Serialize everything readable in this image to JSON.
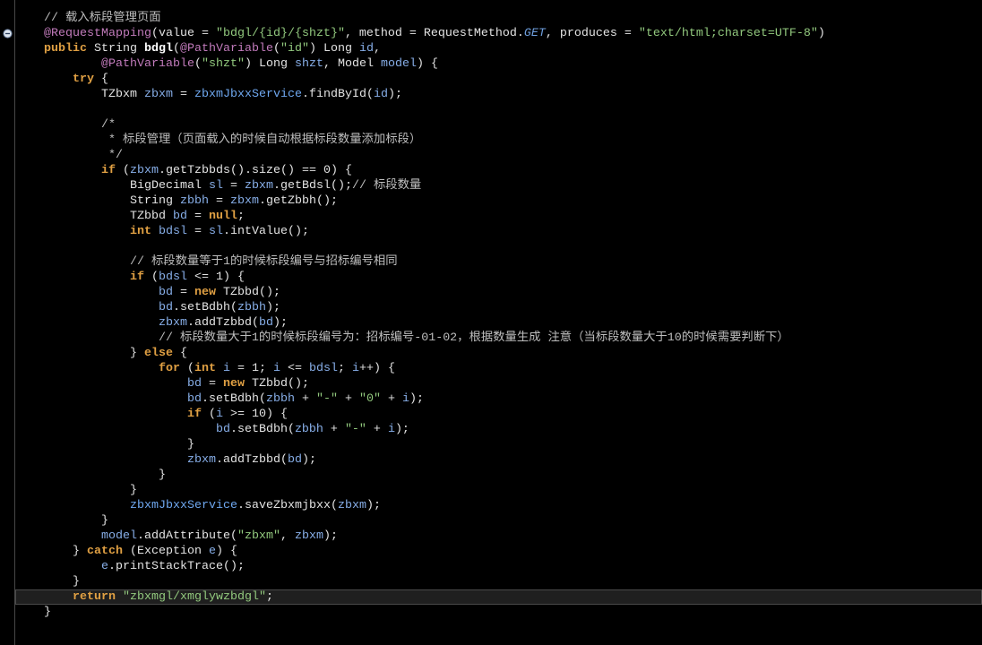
{
  "colors": {
    "background": "#000000",
    "plain": "#e3e3e3",
    "keyword": "#e0a043",
    "annotation": "#c27bbc",
    "string": "#92c97e",
    "comment": "#bdbdbd",
    "variable": "#87aee8",
    "field": "#6fa8f0",
    "static_field": "#6fa0e0",
    "number": "#e3e3e3",
    "method": "#ffffff",
    "current_line": "#1f1f1f",
    "current_line_border": "#4a4a4a",
    "gutter_divider": "#474747"
  },
  "icons": {
    "fold": "fold-collapse-icon"
  },
  "editor": {
    "current_line": 39,
    "fold_markers": [
      2
    ],
    "lines": [
      {
        "tabs": 1,
        "tokens": [
          {
            "comment": "// 载入标段管理页面"
          }
        ]
      },
      {
        "tabs": 1,
        "tokens": [
          {
            "annotation": "@RequestMapping"
          },
          {
            "plain": "(value = "
          },
          {
            "string": "\"bdgl/{id}/{shzt}\""
          },
          {
            "plain": ", method = RequestMethod."
          },
          {
            "static_field": "GET"
          },
          {
            "plain": ", produces = "
          },
          {
            "string": "\"text/html;charset=UTF-8\""
          },
          {
            "plain": ")"
          }
        ]
      },
      {
        "tabs": 1,
        "tokens": [
          {
            "keyword": "public"
          },
          {
            "plain": " String "
          },
          {
            "method": "bdgl"
          },
          {
            "plain": "("
          },
          {
            "annotation": "@PathVariable"
          },
          {
            "plain": "("
          },
          {
            "string": "\"id\""
          },
          {
            "plain": ") Long "
          },
          {
            "variable": "id"
          },
          {
            "plain": ","
          }
        ]
      },
      {
        "tabs": 3,
        "tokens": [
          {
            "annotation": "@PathVariable"
          },
          {
            "plain": "("
          },
          {
            "string": "\"shzt\""
          },
          {
            "plain": ") Long "
          },
          {
            "variable": "shzt"
          },
          {
            "plain": ", Model "
          },
          {
            "variable": "model"
          },
          {
            "plain": ") {"
          }
        ]
      },
      {
        "tabs": 2,
        "tokens": [
          {
            "keyword": "try"
          },
          {
            "plain": " {"
          }
        ]
      },
      {
        "tabs": 3,
        "tokens": [
          {
            "plain": "TZbxm "
          },
          {
            "variable": "zbxm"
          },
          {
            "plain": " = "
          },
          {
            "field": "zbxmJbxxService"
          },
          {
            "plain": ".findById("
          },
          {
            "variable": "id"
          },
          {
            "plain": ");"
          }
        ]
      },
      {
        "tabs": 0,
        "tokens": []
      },
      {
        "tabs": 3,
        "tokens": [
          {
            "comment": "/*"
          }
        ]
      },
      {
        "tabs": 3,
        "tokens": [
          {
            "comment": " * 标段管理（页面载入的时候自动根据标段数量添加标段）"
          }
        ]
      },
      {
        "tabs": 3,
        "tokens": [
          {
            "comment": " */"
          }
        ]
      },
      {
        "tabs": 3,
        "tokens": [
          {
            "keyword": "if"
          },
          {
            "plain": " ("
          },
          {
            "variable": "zbxm"
          },
          {
            "plain": ".getTzbbds().size() == "
          },
          {
            "number": "0"
          },
          {
            "plain": ") {"
          }
        ]
      },
      {
        "tabs": 4,
        "tokens": [
          {
            "plain": "BigDecimal "
          },
          {
            "variable": "sl"
          },
          {
            "plain": " = "
          },
          {
            "variable": "zbxm"
          },
          {
            "plain": ".getBdsl();"
          },
          {
            "comment": "// 标段数量"
          }
        ]
      },
      {
        "tabs": 4,
        "tokens": [
          {
            "plain": "String "
          },
          {
            "variable": "zbbh"
          },
          {
            "plain": " = "
          },
          {
            "variable": "zbxm"
          },
          {
            "plain": ".getZbbh();"
          }
        ]
      },
      {
        "tabs": 4,
        "tokens": [
          {
            "plain": "TZbbd "
          },
          {
            "variable": "bd"
          },
          {
            "plain": " = "
          },
          {
            "keyword": "null"
          },
          {
            "plain": ";"
          }
        ]
      },
      {
        "tabs": 4,
        "tokens": [
          {
            "keyword": "int"
          },
          {
            "plain": " "
          },
          {
            "variable": "bdsl"
          },
          {
            "plain": " = "
          },
          {
            "variable": "sl"
          },
          {
            "plain": ".intValue();"
          }
        ]
      },
      {
        "tabs": 0,
        "tokens": []
      },
      {
        "tabs": 4,
        "tokens": [
          {
            "comment": "// 标段数量等于1的时候标段编号与招标编号相同"
          }
        ]
      },
      {
        "tabs": 4,
        "tokens": [
          {
            "keyword": "if"
          },
          {
            "plain": " ("
          },
          {
            "variable": "bdsl"
          },
          {
            "plain": " <= "
          },
          {
            "number": "1"
          },
          {
            "plain": ") {"
          }
        ]
      },
      {
        "tabs": 5,
        "tokens": [
          {
            "variable": "bd"
          },
          {
            "plain": " = "
          },
          {
            "keyword": "new"
          },
          {
            "plain": " TZbbd();"
          }
        ]
      },
      {
        "tabs": 5,
        "tokens": [
          {
            "variable": "bd"
          },
          {
            "plain": ".setBdbh("
          },
          {
            "variable": "zbbh"
          },
          {
            "plain": ");"
          }
        ]
      },
      {
        "tabs": 5,
        "tokens": [
          {
            "variable": "zbxm"
          },
          {
            "plain": ".addTzbbd("
          },
          {
            "variable": "bd"
          },
          {
            "plain": ");"
          }
        ]
      },
      {
        "tabs": 5,
        "tokens": [
          {
            "comment": "// 标段数量大于1的时候标段编号为：招标编号-01-02，根据数量生成 注意（当标段数量大于10的时候需要判断下）"
          }
        ]
      },
      {
        "tabs": 4,
        "tokens": [
          {
            "plain": "} "
          },
          {
            "keyword": "else"
          },
          {
            "plain": " {"
          }
        ]
      },
      {
        "tabs": 5,
        "tokens": [
          {
            "keyword": "for"
          },
          {
            "plain": " ("
          },
          {
            "keyword": "int"
          },
          {
            "plain": " "
          },
          {
            "variable": "i"
          },
          {
            "plain": " = "
          },
          {
            "number": "1"
          },
          {
            "plain": "; "
          },
          {
            "variable": "i"
          },
          {
            "plain": " <= "
          },
          {
            "variable": "bdsl"
          },
          {
            "plain": "; "
          },
          {
            "variable": "i"
          },
          {
            "plain": "++) {"
          }
        ]
      },
      {
        "tabs": 6,
        "tokens": [
          {
            "variable": "bd"
          },
          {
            "plain": " = "
          },
          {
            "keyword": "new"
          },
          {
            "plain": " TZbbd();"
          }
        ]
      },
      {
        "tabs": 6,
        "tokens": [
          {
            "variable": "bd"
          },
          {
            "plain": ".setBdbh("
          },
          {
            "variable": "zbbh"
          },
          {
            "plain": " + "
          },
          {
            "string": "\"-\""
          },
          {
            "plain": " + "
          },
          {
            "string": "\"0\""
          },
          {
            "plain": " + "
          },
          {
            "variable": "i"
          },
          {
            "plain": ");"
          }
        ]
      },
      {
        "tabs": 6,
        "tokens": [
          {
            "keyword": "if"
          },
          {
            "plain": " ("
          },
          {
            "variable": "i"
          },
          {
            "plain": " >= "
          },
          {
            "number": "10"
          },
          {
            "plain": ") {"
          }
        ]
      },
      {
        "tabs": 7,
        "tokens": [
          {
            "variable": "bd"
          },
          {
            "plain": ".setBdbh("
          },
          {
            "variable": "zbbh"
          },
          {
            "plain": " + "
          },
          {
            "string": "\"-\""
          },
          {
            "plain": " + "
          },
          {
            "variable": "i"
          },
          {
            "plain": ");"
          }
        ]
      },
      {
        "tabs": 6,
        "tokens": [
          {
            "plain": "}"
          }
        ]
      },
      {
        "tabs": 6,
        "tokens": [
          {
            "variable": "zbxm"
          },
          {
            "plain": ".addTzbbd("
          },
          {
            "variable": "bd"
          },
          {
            "plain": ");"
          }
        ]
      },
      {
        "tabs": 5,
        "tokens": [
          {
            "plain": "}"
          }
        ]
      },
      {
        "tabs": 4,
        "tokens": [
          {
            "plain": "}"
          }
        ]
      },
      {
        "tabs": 4,
        "tokens": [
          {
            "field": "zbxmJbxxService"
          },
          {
            "plain": ".saveZbxmjbxx("
          },
          {
            "variable": "zbxm"
          },
          {
            "plain": ");"
          }
        ]
      },
      {
        "tabs": 3,
        "tokens": [
          {
            "plain": "}"
          }
        ]
      },
      {
        "tabs": 3,
        "tokens": [
          {
            "variable": "model"
          },
          {
            "plain": ".addAttribute("
          },
          {
            "string": "\"zbxm\""
          },
          {
            "plain": ", "
          },
          {
            "variable": "zbxm"
          },
          {
            "plain": ");"
          }
        ]
      },
      {
        "tabs": 2,
        "tokens": [
          {
            "plain": "} "
          },
          {
            "keyword": "catch"
          },
          {
            "plain": " (Exception "
          },
          {
            "variable": "e"
          },
          {
            "plain": ") {"
          }
        ]
      },
      {
        "tabs": 3,
        "tokens": [
          {
            "variable": "e"
          },
          {
            "plain": ".printStackTrace();"
          }
        ]
      },
      {
        "tabs": 2,
        "tokens": [
          {
            "plain": "}"
          }
        ]
      },
      {
        "tabs": 2,
        "tokens": [
          {
            "keyword": "return"
          },
          {
            "plain": " "
          },
          {
            "string": "\"zbxmgl/xmglywzbdgl\""
          },
          {
            "plain": ";"
          }
        ]
      },
      {
        "tabs": 1,
        "tokens": [
          {
            "plain": "}"
          }
        ]
      }
    ]
  }
}
